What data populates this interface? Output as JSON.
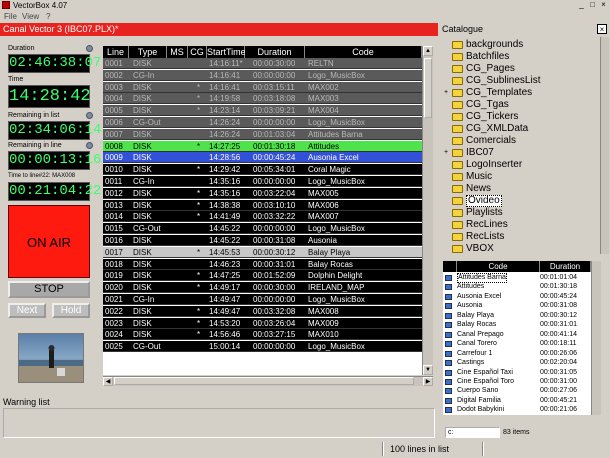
{
  "window": {
    "title": "VectorBox 4.07",
    "min": "_",
    "max": "□",
    "close": "×"
  },
  "menu": [
    "File",
    "View",
    "?"
  ],
  "channel": {
    "title": "Canal Vector 3  (IBC07.PLX)*"
  },
  "catalogue": {
    "title": "Catalogue",
    "close": "×"
  },
  "left": {
    "duration_label": "Duration",
    "duration": "02:46:38:07",
    "time_label": "Time",
    "time": "14:28:42",
    "remaining_list_label": "Remaining in list",
    "remaining_list": "02:34:06:14",
    "remaining_line_label": "Remaining in line",
    "remaining_line": "00:00:13:16",
    "time_to_line_label": "Time to line#22: MAX008",
    "time_to_line": "00:21:04:22",
    "on_air": "ON AIR",
    "stop": "STOP",
    "next": "Next",
    "hold": "Hold"
  },
  "grid": {
    "columns": [
      "Line",
      "Type",
      "MS",
      "CG",
      "StartTime",
      "Duration",
      "Code"
    ],
    "rows": [
      {
        "line": "0001",
        "type": "DISK",
        "ms": "",
        "cg": "",
        "start": "14:16:11*",
        "dur": "00:00:30:00",
        "code": "RELTN",
        "state": "past"
      },
      {
        "line": "0002",
        "type": "CG-In",
        "ms": "",
        "cg": "",
        "start": "14:16:41",
        "dur": "00:00:00:00",
        "code": "Logo_MusicBox",
        "state": "past"
      },
      {
        "line": "0003",
        "type": "DISK",
        "ms": "",
        "cg": "*",
        "start": "14:16:41",
        "dur": "00:03:15:11",
        "code": "MAX002",
        "state": "past"
      },
      {
        "line": "0004",
        "type": "DISK",
        "ms": "",
        "cg": "*",
        "start": "14:19:58",
        "dur": "00:03:18:08",
        "code": "MAX003",
        "state": "past"
      },
      {
        "line": "0005",
        "type": "DISK",
        "ms": "",
        "cg": "*",
        "start": "14:23:14",
        "dur": "00:03:09:21",
        "code": "MAX004",
        "state": "past"
      },
      {
        "line": "0006",
        "type": "CG-Out",
        "ms": "",
        "cg": "",
        "start": "14:26:24",
        "dur": "00:00:00:00",
        "code": "Logo_MusicBox",
        "state": "past"
      },
      {
        "line": "0007",
        "type": "DISK",
        "ms": "",
        "cg": "",
        "start": "14:26:24",
        "dur": "00:01:03:04",
        "code": "Attitudes Barna",
        "state": "past"
      },
      {
        "line": "0008",
        "type": "DISK",
        "ms": "",
        "cg": "*",
        "start": "14:27:25",
        "dur": "00:01:30:18",
        "code": "Attitudes",
        "state": "onair"
      },
      {
        "line": "0009",
        "type": "DISK",
        "ms": "",
        "cg": "",
        "start": "14:28:56",
        "dur": "00:00:45:24",
        "code": "Ausonia Excel",
        "state": "next"
      },
      {
        "line": "0010",
        "type": "DISK",
        "ms": "",
        "cg": "*",
        "start": "14:29:42",
        "dur": "00:05:34:01",
        "code": "Coral Magic",
        "state": ""
      },
      {
        "line": "0011",
        "type": "CG-In",
        "ms": "",
        "cg": "",
        "start": "14:35:16",
        "dur": "00:00:00:00",
        "code": "Logo_MusicBox",
        "state": ""
      },
      {
        "line": "0012",
        "type": "DISK",
        "ms": "",
        "cg": "*",
        "start": "14:35:16",
        "dur": "00:03:22:04",
        "code": "MAX005",
        "state": ""
      },
      {
        "line": "0013",
        "type": "DISK",
        "ms": "",
        "cg": "*",
        "start": "14:38:38",
        "dur": "00:03:10:10",
        "code": "MAX006",
        "state": ""
      },
      {
        "line": "0014",
        "type": "DISK",
        "ms": "",
        "cg": "*",
        "start": "14:41:49",
        "dur": "00:03:32:22",
        "code": "MAX007",
        "state": ""
      },
      {
        "line": "0015",
        "type": "CG-Out",
        "ms": "",
        "cg": "",
        "start": "14:45:22",
        "dur": "00:00:00:00",
        "code": "Logo_MusicBox",
        "state": ""
      },
      {
        "line": "0016",
        "type": "DISK",
        "ms": "",
        "cg": "",
        "start": "14:45:22",
        "dur": "00:00:31:08",
        "code": "Ausonia",
        "state": ""
      },
      {
        "line": "0017",
        "type": "DISK",
        "ms": "",
        "cg": "*",
        "start": "14:45:53",
        "dur": "00:00:30:12",
        "code": "Balay Playa",
        "state": "selected"
      },
      {
        "line": "0018",
        "type": "DISK",
        "ms": "",
        "cg": "",
        "start": "14:46:23",
        "dur": "00:00:31:01",
        "code": "Balay Rocas",
        "state": ""
      },
      {
        "line": "0019",
        "type": "DISK",
        "ms": "",
        "cg": "*",
        "start": "14:47:25",
        "dur": "00:01:52:09",
        "code": "Dolphin Delight",
        "state": ""
      },
      {
        "line": "0020",
        "type": "DISK",
        "ms": "",
        "cg": "*",
        "start": "14:49:17",
        "dur": "00:00:30:00",
        "code": "IRELAND_MAP",
        "state": ""
      },
      {
        "line": "0021",
        "type": "CG-In",
        "ms": "",
        "cg": "",
        "start": "14:49:47",
        "dur": "00:00:00:00",
        "code": "Logo_MusicBox",
        "state": ""
      },
      {
        "line": "0022",
        "type": "DISK",
        "ms": "",
        "cg": "*",
        "start": "14:49:47",
        "dur": "00:03:32:08",
        "code": "MAX008",
        "state": ""
      },
      {
        "line": "0023",
        "type": "DISK",
        "ms": "",
        "cg": "*",
        "start": "14:53:20",
        "dur": "00:03:26:04",
        "code": "MAX009",
        "state": ""
      },
      {
        "line": "0024",
        "type": "DISK",
        "ms": "",
        "cg": "*",
        "start": "14:56:46",
        "dur": "00:03:27:15",
        "code": "MAX010",
        "state": ""
      },
      {
        "line": "0025",
        "type": "CG-Out",
        "ms": "",
        "cg": "",
        "start": "15:00:14",
        "dur": "00:00:00:00",
        "code": "Logo_MusicBox",
        "state": ""
      }
    ]
  },
  "catalog_tree": [
    {
      "name": "backgrounds",
      "plus": ""
    },
    {
      "name": "Batchfiles",
      "plus": ""
    },
    {
      "name": "CG_Pages",
      "plus": ""
    },
    {
      "name": "CG_SublinesList",
      "plus": ""
    },
    {
      "name": "CG_Templates",
      "plus": "+"
    },
    {
      "name": "CG_Tgas",
      "plus": ""
    },
    {
      "name": "CG_Tickers",
      "plus": ""
    },
    {
      "name": "CG_XMLData",
      "plus": ""
    },
    {
      "name": "Comercials",
      "plus": ""
    },
    {
      "name": "IBC07",
      "plus": "+"
    },
    {
      "name": "LogoInserter",
      "plus": ""
    },
    {
      "name": "Music",
      "plus": ""
    },
    {
      "name": "News",
      "plus": ""
    },
    {
      "name": "Ovideo",
      "plus": "",
      "selected": true
    },
    {
      "name": "Playlists",
      "plus": ""
    },
    {
      "name": "RecLines",
      "plus": ""
    },
    {
      "name": "RecLists",
      "plus": ""
    },
    {
      "name": "VBOX",
      "plus": ""
    }
  ],
  "catalog_table": {
    "columns": [
      "Code",
      "Duration"
    ],
    "rows": [
      {
        "code": "Attitudes Barna",
        "dur": "00:01:01:04"
      },
      {
        "code": "Attitudes",
        "dur": "00:01:30:18"
      },
      {
        "code": "Ausonia Excel",
        "dur": "00:00:45:24"
      },
      {
        "code": "Ausonia",
        "dur": "00:00:31:08"
      },
      {
        "code": "Balay Playa",
        "dur": "00:00:30:12"
      },
      {
        "code": "Balay Rocas",
        "dur": "00:00:31:01"
      },
      {
        "code": "Canal Prepago",
        "dur": "00:00:41:14"
      },
      {
        "code": "Canal Torero",
        "dur": "00:00:18:11"
      },
      {
        "code": "Carrefour 1",
        "dur": "00:00:26:06"
      },
      {
        "code": "Castings",
        "dur": "00:02:20:04"
      },
      {
        "code": "Cine Español Taxi",
        "dur": "00:00:31:05"
      },
      {
        "code": "Cine Español Toro",
        "dur": "00:00:31:00"
      },
      {
        "code": "Cuerpo Sano",
        "dur": "00:00:27:06"
      },
      {
        "code": "Digital Familia",
        "dur": "00:00:45:21"
      },
      {
        "code": "Dodot Babykini",
        "dur": "00:00:21:06"
      }
    ],
    "drive": "c:",
    "count": "83 items"
  },
  "warning": {
    "label": "Warning list"
  },
  "status": {
    "text": "100 lines in list"
  }
}
